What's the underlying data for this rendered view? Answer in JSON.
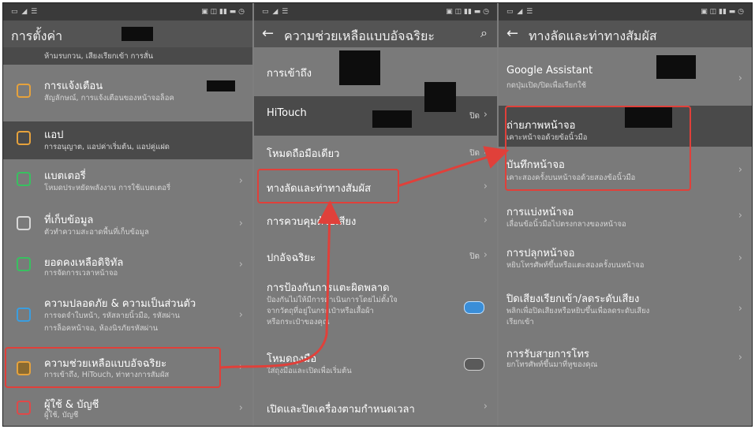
{
  "panels": [
    {
      "title": "การตั้งค่า",
      "items": [
        {
          "sub": "ห้ามรบกวน, เสียงเรียกเข้า การสั่น"
        },
        {
          "title": "การแจ้งเตือน",
          "sub": "สัญลักษณ์, การแจ้งเตือนของหน้าจอล็อค"
        },
        {
          "title": "แอป",
          "sub": "การอนุญาต, แอปค่าเริ่มต้น, แอปคู่แฝด"
        },
        {
          "title": "แบตเตอรี่",
          "sub": "โหมดประหยัดพลังงาน การใช้แบตเตอรี่"
        },
        {
          "title": "ที่เก็บข้อมูล",
          "sub": "ตัวทำความสะอาดพื้นที่เก็บข้อมูล"
        },
        {
          "title": "ยอดคงเหลือดิจิทัล",
          "sub": "การจัดการเวลาหน้าจอ"
        },
        {
          "title": "ความปลอดภัย & ความเป็นส่วนตัว",
          "sub": "การจดจำใบหน้า, รหัสลายนิ้วมือ, รหัสผ่าน",
          "sub2": "การล็อคหน้าจอ, ห้องนิรภัยรหัสผ่าน"
        },
        {
          "title": "ความช่วยเหลือแบบอัจฉริยะ",
          "sub": "การเข้าถึง, HiTouch, ท่าทางการสัมผัส"
        },
        {
          "title": "ผู้ใช้ & บัญชี",
          "sub": "ผู้ใช้, บัญชี"
        }
      ]
    },
    {
      "title": "ความช่วยเหลือแบบอัจฉริยะ",
      "items": [
        {
          "title": "การเข้าถึง"
        },
        {
          "title": "HiTouch",
          "value": "ปิด"
        },
        {
          "title": "โหมดถือมือเดียว",
          "value": "ปิด"
        },
        {
          "title": "ทางลัดและท่าทางสัมผัส"
        },
        {
          "title": "การควบคุมด้วยเสียง"
        },
        {
          "title": "ปกอัจฉริยะ",
          "value": "ปิด"
        },
        {
          "title": "การป้องกันการแตะผิดพลาด",
          "sub": "ป้องกันไม่ให้มีการดำเนินการโดยไม่ตั้งใจ",
          "sub2": "จากวัตถุที่อยู่ในกระเป๋าหรือเสื้อผ้า",
          "sub3": "หรือกระเป๋าของคุณ"
        },
        {
          "title": "โหมดถุงมือ",
          "sub": "ใส่ถุงมือและเปิดเพื่อเริ่มต้น"
        },
        {
          "title": "เปิดและปิดเครื่องตามกำหนดเวลา"
        }
      ]
    },
    {
      "title": "ทางลัดและท่าทางสัมผัส",
      "items": [
        {
          "title": "Google Assistant",
          "sub": "กดปุ่มเปิด/ปิดเพื่อเรียกใช้"
        },
        {
          "title": "ถ่ายภาพหน้าจอ",
          "sub": "เคาะหน้าจอด้วยข้อนิ้วมือ"
        },
        {
          "title": "บันทึกหน้าจอ",
          "sub": "เคาะสองครั้งบนหน้าจอด้วยสองข้อนิ้วมือ"
        },
        {
          "title": "การแบ่งหน้าจอ",
          "sub": "เลื่อนข้อนิ้วมือไปตรงกลางของหน้าจอ"
        },
        {
          "title": "การปลุกหน้าจอ",
          "sub": "หยิบโทรศัพท์ขึ้นหรือแตะสองครั้งบนหน้าจอ"
        },
        {
          "title": "ปิดเสียงเรียกเข้า/ลดระดับเสียง",
          "sub": "พลิกเพื่อปิดเสียงหรือหยิบขึ้นเพื่อลดระดับเสียง",
          "sub2": "เรียกเข้า"
        },
        {
          "title": "การรับสายการโทร",
          "sub": "ยกโทรศัพท์ขึ้นมาที่หูของคุณ"
        }
      ]
    }
  ],
  "colors": {
    "highlight": "#e0403a",
    "toggle_on": "#3a8ed8"
  }
}
